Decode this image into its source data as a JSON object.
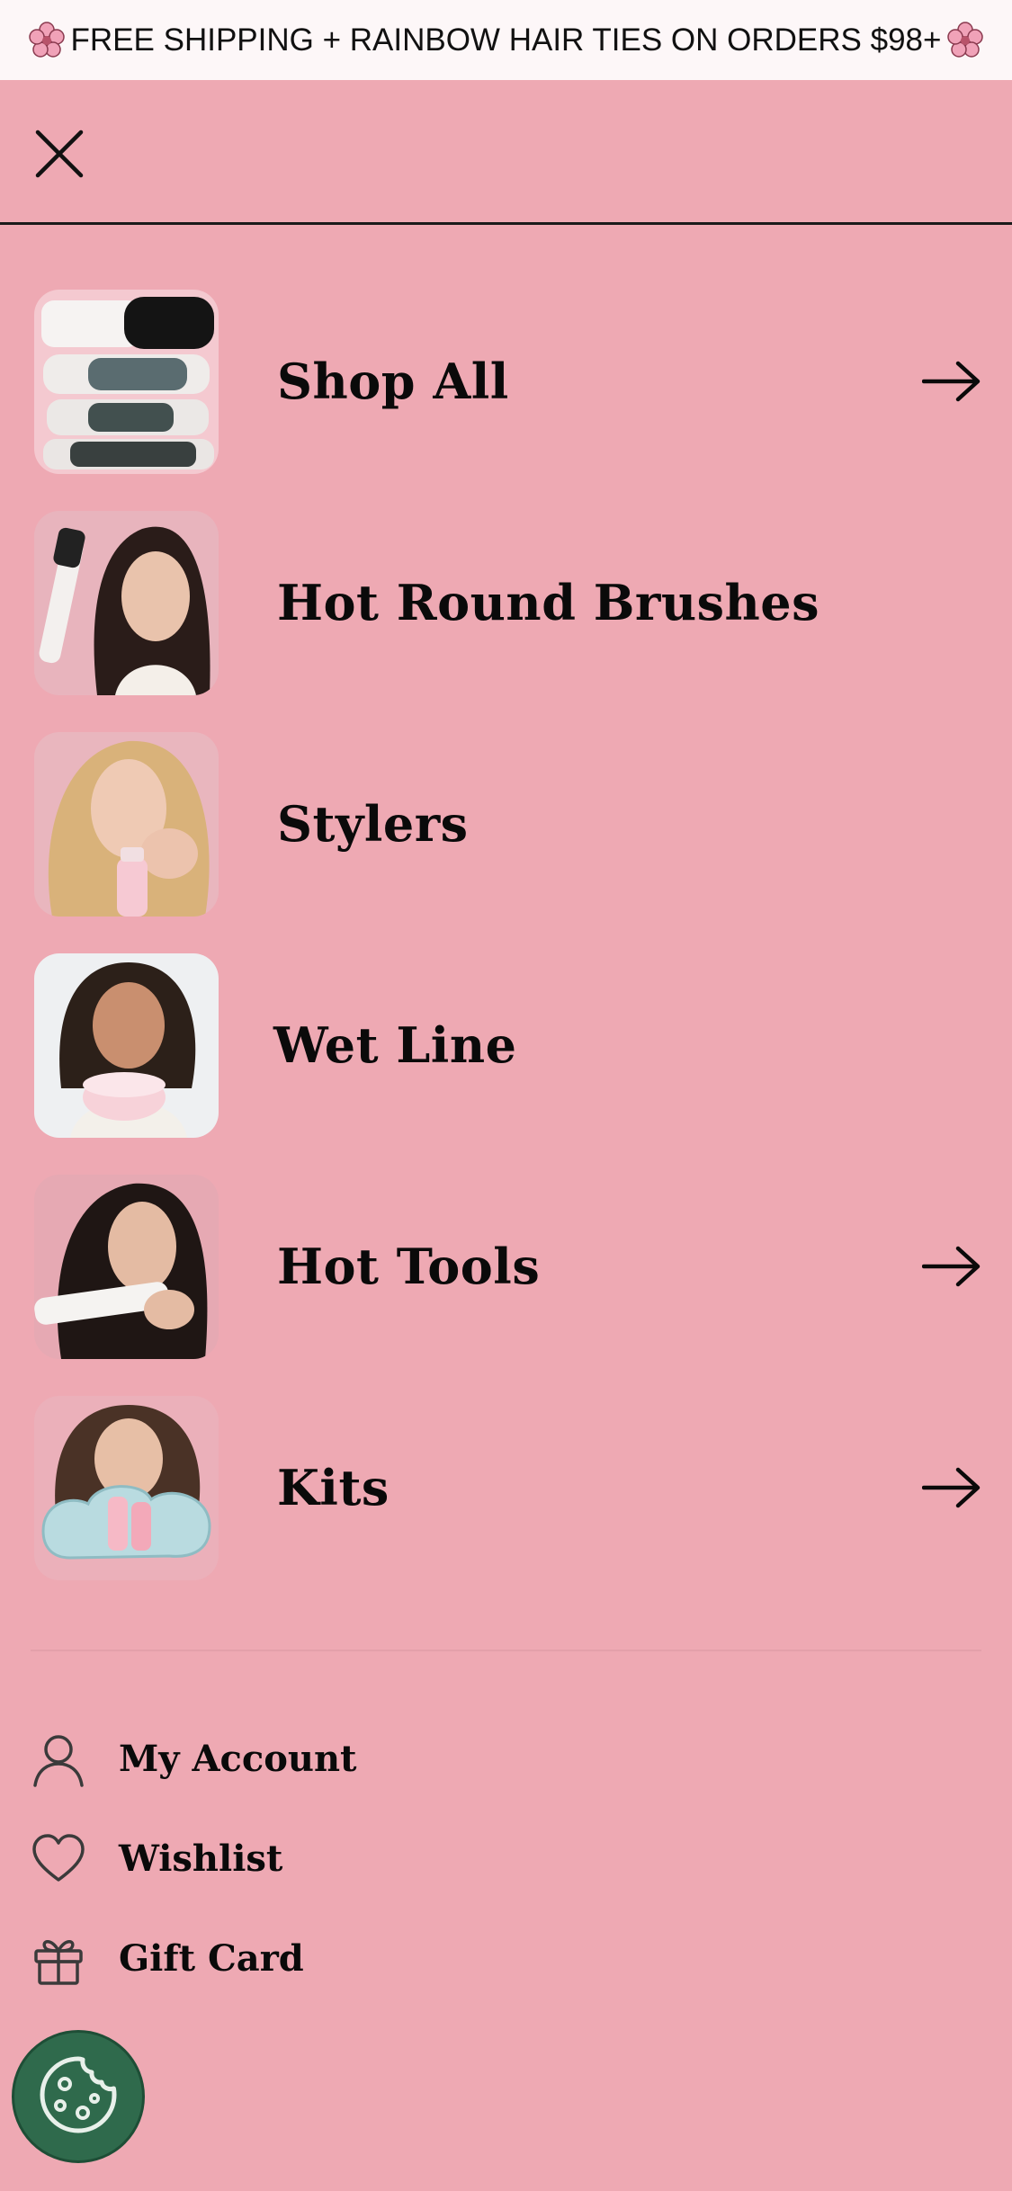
{
  "announcement": {
    "text": "FREE SHIPPING + RAINBOW HAIR TIES ON ORDERS $98+",
    "left_icon": "flower-icon",
    "right_icon": "flower-icon"
  },
  "header": {
    "close_icon": "close-icon"
  },
  "nav": {
    "items": [
      {
        "label": "Shop All",
        "has_arrow": true,
        "thumb": "brushes"
      },
      {
        "label": "Hot Round Brushes",
        "has_arrow": false,
        "thumb": "model-brush"
      },
      {
        "label": "Stylers",
        "has_arrow": false,
        "thumb": "model-blonde"
      },
      {
        "label": "Wet Line",
        "has_arrow": false,
        "thumb": "model-jar"
      },
      {
        "label": "Hot Tools",
        "has_arrow": true,
        "thumb": "model-straightener"
      },
      {
        "label": "Kits",
        "has_arrow": true,
        "thumb": "model-kit"
      }
    ]
  },
  "utility": {
    "items": [
      {
        "label": "My Account",
        "icon": "user-icon"
      },
      {
        "label": "Wishlist",
        "icon": "heart-icon"
      },
      {
        "label": "Gift Card",
        "icon": "gift-icon"
      }
    ]
  },
  "cookie_button": {
    "icon": "cookie-icon"
  },
  "colors": {
    "background": "#eea9b3",
    "announcement_bg": "#fdf7f8",
    "text": "#0a0a0a",
    "cookie_bg": "#2f6a4c"
  }
}
